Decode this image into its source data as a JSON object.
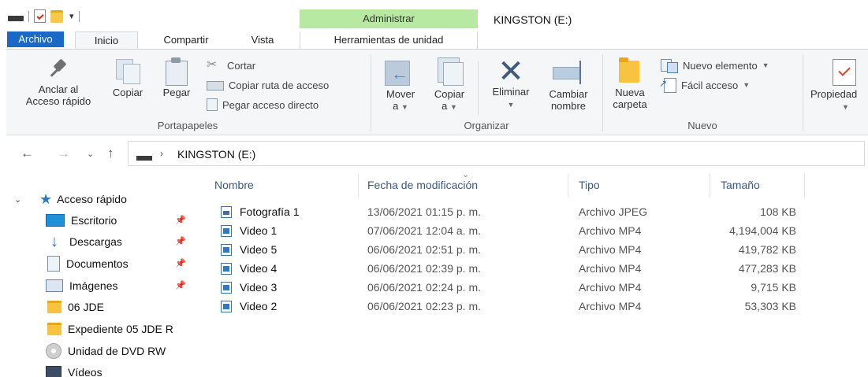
{
  "window": {
    "title": "KINGSTON (E:)",
    "context_tab_header": "Administrar",
    "quick_access_toolbar_dropdown": "▾"
  },
  "tabs": {
    "archivo": "Archivo",
    "inicio": "Inicio",
    "compartir": "Compartir",
    "vista": "Vista",
    "herramientas": "Herramientas de unidad"
  },
  "ribbon": {
    "portapapeles": {
      "label": "Portapapeles",
      "anclar_line1": "Anclar al",
      "anclar_line2": "Acceso rápido",
      "copiar": "Copiar",
      "pegar": "Pegar",
      "cortar": "Cortar",
      "copiar_ruta": "Copiar ruta de acceso",
      "pegar_acceso": "Pegar acceso directo"
    },
    "organizar": {
      "label": "Organizar",
      "mover_line1": "Mover",
      "mover_line2": "a",
      "copiar_line1": "Copiar",
      "copiar_line2": "a",
      "eliminar": "Eliminar",
      "cambiar_line1": "Cambiar",
      "cambiar_line2": "nombre"
    },
    "nuevo": {
      "label": "Nuevo",
      "nueva_line1": "Nueva",
      "nueva_line2": "carpeta",
      "nuevo_elemento": "Nuevo elemento",
      "facil_acceso": "Fácil acceso"
    },
    "abrir": {
      "propiedades": "Propiedad"
    }
  },
  "address_bar": {
    "breadcrumb": "KINGSTON (E:)"
  },
  "nav_pane": {
    "quick_access": "Acceso rápido",
    "items": [
      {
        "label": "Escritorio",
        "pinned": true
      },
      {
        "label": "Descargas",
        "pinned": true
      },
      {
        "label": "Documentos",
        "pinned": true
      },
      {
        "label": "Imágenes",
        "pinned": true
      },
      {
        "label": "06 JDE",
        "pinned": false
      },
      {
        "label": "Expediente 05 JDE R",
        "pinned": false
      },
      {
        "label": "Unidad de DVD RW",
        "pinned": false
      },
      {
        "label": "Vídeos",
        "pinned": false
      }
    ]
  },
  "file_list": {
    "columns": [
      "Nombre",
      "Fecha de modificación",
      "Tipo",
      "Tamaño"
    ],
    "rows": [
      {
        "name": "Fotografía 1",
        "date": "13/06/2021 01:15 p. m.",
        "type": "Archivo JPEG",
        "size": "108 KB"
      },
      {
        "name": "Video 1",
        "date": "07/06/2021 12:04 a. m.",
        "type": "Archivo MP4",
        "size": "4,194,004 KB"
      },
      {
        "name": "Video 5",
        "date": "06/06/2021 02:51 p. m.",
        "type": "Archivo MP4",
        "size": "419,782 KB"
      },
      {
        "name": "Video 4",
        "date": "06/06/2021 02:39 p. m.",
        "type": "Archivo MP4",
        "size": "477,283 KB"
      },
      {
        "name": "Video 3",
        "date": "06/06/2021 02:24 p. m.",
        "type": "Archivo MP4",
        "size": "9,715 KB"
      },
      {
        "name": "Video 2",
        "date": "06/06/2021 02:23 p. m.",
        "type": "Archivo MP4",
        "size": "53,303 KB"
      }
    ]
  },
  "colors": {
    "archivo_tab": "#1a69c7",
    "context_header": "#b7e9a3",
    "column_header_text": "#3b5a80"
  }
}
